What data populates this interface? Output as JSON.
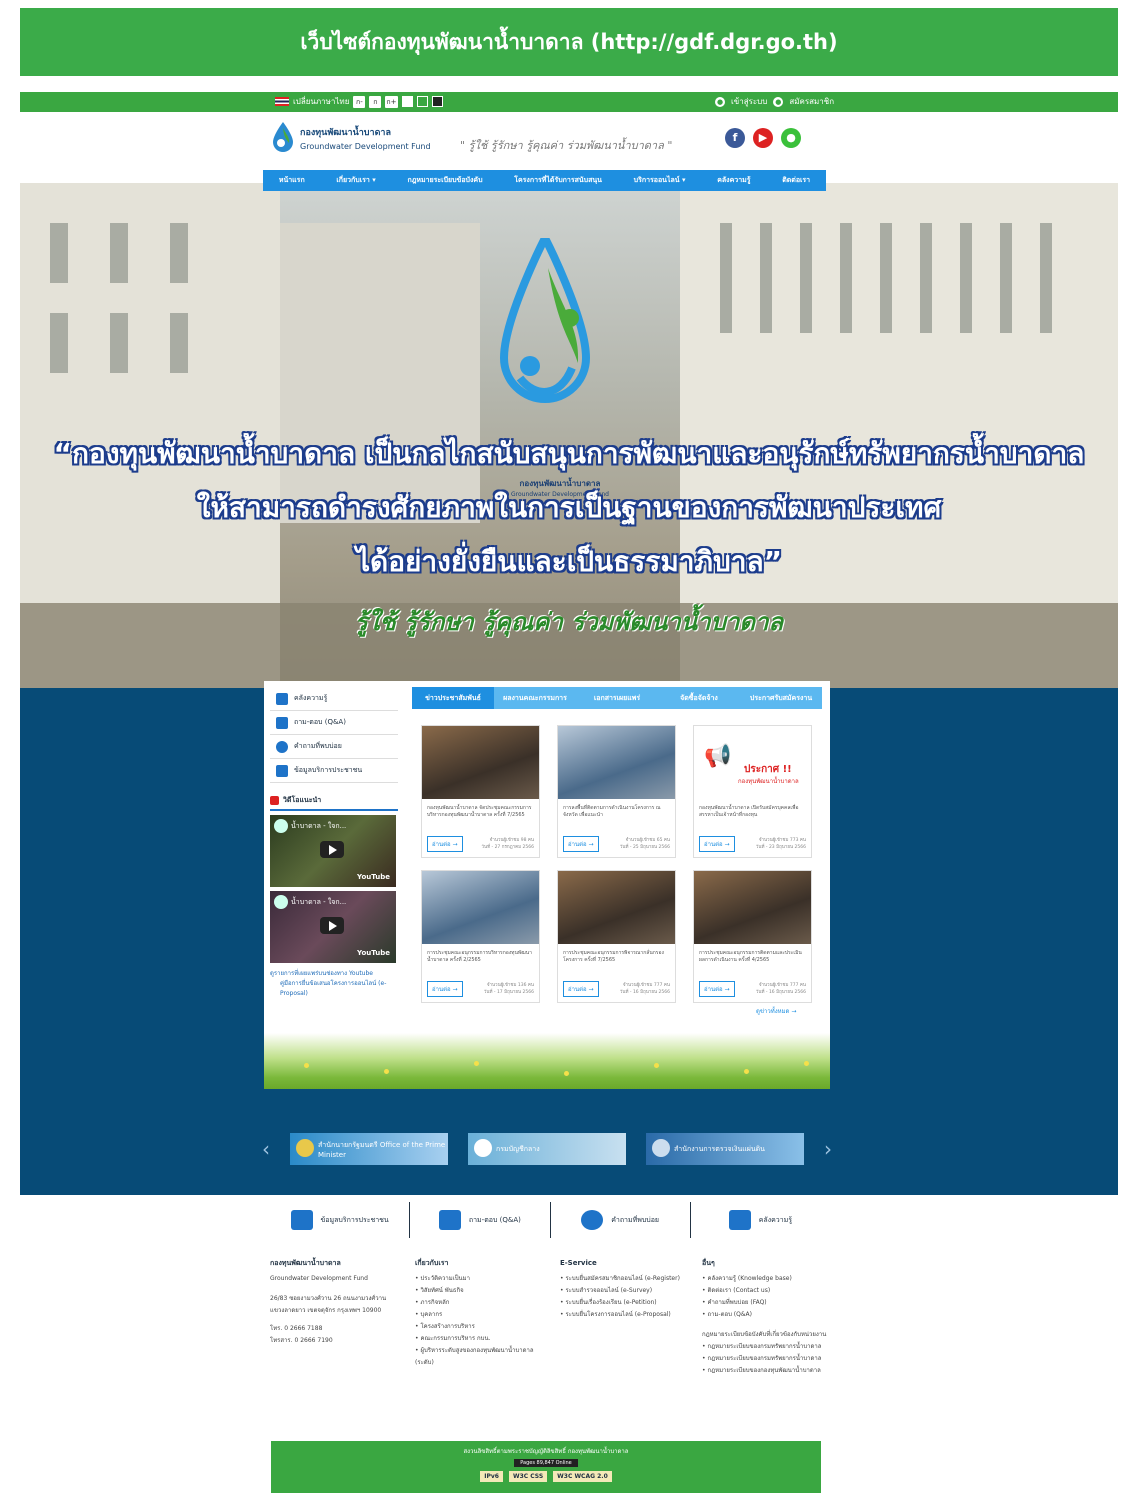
{
  "banner": {
    "title": "เว็บไซต์กองทุนพัฒนาน้ำบาดาล (http://gdf.dgr.go.th)"
  },
  "utility": {
    "lang": "เปลี่ยนภาษาไทย",
    "font_sizes": [
      "ก-",
      "ก",
      "ก+"
    ],
    "right": [
      "เข้าสู่ระบบ",
      "สมัครสมาชิก"
    ]
  },
  "header": {
    "org_name_th": "กองทุนพัฒนาน้ำบาดาล",
    "org_name_en": "Groundwater Development Fund",
    "slogan": "\" รู้ใช้ รู้รักษา รู้คุณค่า ร่วมพัฒนาน้ำบาดาล \"",
    "social": [
      "f",
      "▶",
      "●"
    ]
  },
  "nav": [
    "หน้าแรก",
    "เกี่ยวกับเรา ▾",
    "กฎหมายระเบียบข้อบังคับ",
    "โครงการที่ได้รับการสนับสนุน",
    "บริการออนไลน์ ▾",
    "คลังความรู้",
    "ติดต่อเรา"
  ],
  "hero": {
    "org_th": "กองทุนพัฒนาน้ำบาดาล",
    "org_en": "Groundwater Development Fund",
    "quote_lines": [
      "“กองทุนพัฒนาน้ำบาดาล เป็นกลไกสนับสนุนการพัฒนาและอนุรักษ์ทรัพยากรน้ำบาดาล",
      "ให้สามารถดำรงศักยภาพในการเป็นฐานของการพัฒนาประเทศ",
      "ได้อย่างยั่งยืนและเป็นธรรมาภิบาล”"
    ],
    "motto": "รู้ใช้ รู้รักษา รู้คุณค่า ร่วมพัฒนาน้ำบาดาล"
  },
  "sidebar": {
    "items": [
      "คลังความรู้",
      "ถาม-ตอบ (Q&A)",
      "คำถามที่พบบ่อย",
      "ข้อมูลบริการประชาชน"
    ],
    "video_heading": "วิดีโอแนะนำ",
    "videos": [
      "น้ำบาดาล - ใจก...",
      "น้ำบาดาล - ใจก..."
    ],
    "yt_label": "YouTube",
    "link_title": "ดูรายการที่เผยแพร่บนช่องทาง Youtube",
    "link_sub": "คู่มือการยื่นข้อเสนอโครงการออนไลน์ (e-Proposal)"
  },
  "tabs": [
    "ข่าวประชาสัมพันธ์",
    "ผลงานคณะกรรมการ",
    "เอกสารเผยแพร่",
    "จัดซื้อจัดจ้าง",
    "ประกาศรับสมัครงาน"
  ],
  "cards": [
    {
      "desc": "กองทุนพัฒนาน้ำบาดาล จัดประชุมคณะกรรมการบริหารกองทุนพัฒนาน้ำบาดาล ครั้งที่ 7/2565",
      "views": "จำนวนผู้เข้าชม 98 คน",
      "date": "วันที่ - 27 กรกฎาคม 2566",
      "more": "อ่านต่อ →"
    },
    {
      "desc": "การลงพื้นที่ติดตามการดำเนินงานโครงการ ณ จังหวัด เพื่อแนะนำ",
      "views": "จำนวนผู้เข้าชม 65 คน",
      "date": "วันที่ - 25 มิถุนายน 2566",
      "more": "อ่านต่อ →"
    },
    {
      "desc": "กองทุนพัฒนาน้ำบาดาล เปิดรับสมัครบุคคลเพื่อสรรหาเป็นเจ้าหน้าที่กองทุน",
      "views": "จำนวนผู้เข้าชม 773 คน",
      "date": "วันที่ - 23 มิถุนายน 2566",
      "more": "อ่านต่อ →",
      "poster_title": "ประกาศ !!",
      "poster_sub": "กองทุนพัฒนาน้ำบาดาล"
    },
    {
      "desc": "การประชุมคณะอนุกรรมการบริหารกองทุนพัฒนาน้ำบาดาล ครั้งที่ 2/2565",
      "views": "จำนวนผู้เข้าชม 136 คน",
      "date": "วันที่ - 17 มิถุนายน 2566",
      "more": "อ่านต่อ →"
    },
    {
      "desc": "การประชุมคณะอนุกรรมการพิจารณากลั่นกรองโครงการ ครั้งที่ 7/2565",
      "views": "จำนวนผู้เข้าชม 777 คน",
      "date": "วันที่ - 16 มิถุนายน 2566",
      "more": "อ่านต่อ →"
    },
    {
      "desc": "การประชุมคณะอนุกรรมการติดตามและประเมินผลการดำเนินงาน ครั้งที่ 4/2565",
      "views": "จำนวนผู้เข้าชม 777 คน",
      "date": "วันที่ - 16 มิถุนายน 2566",
      "more": "อ่านต่อ →"
    }
  ],
  "see_all": "ดูข่าวทั้งหมด →",
  "partners": [
    "สำนักนายกรัฐมนตรี Office of the Prime Minister",
    "กรมบัญชีกลาง",
    "สำนักงานการตรวจเงินแผ่นดิน"
  ],
  "quick_links": [
    "ข้อมูลบริการประชาชน",
    "ถาม-ตอบ (Q&A)",
    "คำถามที่พบบ่อย",
    "คลังความรู้"
  ],
  "footer": {
    "org_th": "กองทุนพัฒนาน้ำบาดาล",
    "org_en": "Groundwater Development Fund",
    "address": "26/83 ซอยงามวงศ์วาน 26 ถนนงามวงศ์วาน แขวงลาดยาว เขตจตุจักร กรุงเทพฯ 10900",
    "tel": "โทร. 0 2666 7188",
    "fax": "โทรสาร. 0 2666 7190",
    "col2_title": "เกี่ยวกับเรา",
    "col2_items": [
      "ประวัติความเป็นมา",
      "วิสัยทัศน์ พันธกิจ",
      "ภารกิจหลัก",
      "บุคลากร",
      "โครงสร้างการบริหาร",
      "คณะกรรมการบริหาร กบน.",
      "ผู้บริหารระดับสูงของกองทุนพัฒนาน้ำบาดาล (ระดับ)"
    ],
    "col3_title": "E-Service",
    "col3_items": [
      "ระบบยื่นสมัครสมาชิกออนไลน์ (e-Register)",
      "ระบบสำรวจออนไลน์ (e-Survey)",
      "ระบบยื่นเรื่องร้องเรียน (e-Petition)",
      "ระบบยื่นโครงการออนไลน์ (e-Proposal)"
    ],
    "col4_title": "อื่นๆ",
    "col4_items": [
      "คลังความรู้ (Knowledge base)",
      "ติดต่อเรา (Contact us)",
      "คำถามที่พบบ่อย (FAQ)",
      "ถาม-ตอบ (Q&A)"
    ],
    "col4_title2": "กฎหมายระเบียบข้อบังคับที่เกี่ยวข้องกับหน่วยงาน",
    "col4_items2": [
      "กฎหมายระเบียบของกรมทรัพยากรน้ำบาดาล",
      "กฎหมายระเบียบของกรมทรัพยากรน้ำบาดาล",
      "กฎหมายระเบียบของกองทุนพัฒนาน้ำบาดาล"
    ]
  },
  "copyright": {
    "line": "สงวนลิขสิทธิ์ตามพระราชบัญญัติลิขสิทธิ์ กองทุนพัฒนาน้ำบาดาล",
    "counter": "Pages 89,847 Online",
    "badges": [
      "IPv6",
      "W3C CSS",
      "W3C WCAG 2.0"
    ]
  }
}
